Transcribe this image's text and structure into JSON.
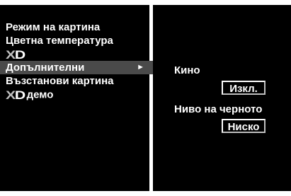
{
  "menu": {
    "items": [
      {
        "label": "Режим на картина"
      },
      {
        "label": "Цветна температура"
      },
      {
        "logo_x": "X",
        "logo_d": "D"
      },
      {
        "label": "Допълнителни",
        "arrow": "►"
      },
      {
        "label": "Възстанови картина"
      },
      {
        "logo_x": "X",
        "logo_d": "D",
        "label": "демо"
      }
    ]
  },
  "submenu": {
    "cinema_label": "Кино",
    "cinema_value": "Изкл.",
    "black_level_label": "Ниво на черното",
    "black_level_value": "Ниско"
  },
  "colors": {
    "background": "#000000",
    "frame": "#ffffff",
    "selection": "#4a4a4a",
    "text": "#ffffff"
  }
}
